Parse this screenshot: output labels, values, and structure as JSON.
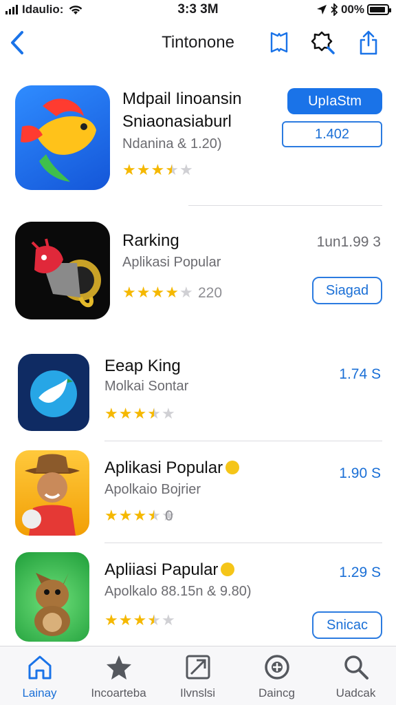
{
  "status_bar": {
    "carrier": "Idaulio:",
    "time": "3:3 3M",
    "battery": "00%",
    "battery_level": 0.9
  },
  "nav": {
    "title": "Tintonone",
    "icons": [
      "chevron-left-icon",
      "bookmark-icon",
      "search-badge-icon",
      "share-icon"
    ]
  },
  "apps": [
    {
      "name_line1": "Mdpail Iinoansin",
      "name_line2": "Sniaonasiaburl",
      "subtitle": "Ndanina & 1.20)",
      "rating": 3.5,
      "primary_button": "UpIaStm",
      "price_button": "1.402"
    },
    {
      "name": "Rarking",
      "subtitle": "Aplikasi Popular",
      "rating": 4,
      "rating_count": "220",
      "price": "1un1.99 3",
      "button": "Siagad"
    },
    {
      "name": "Eeap King",
      "subtitle": "Molkai Sontar",
      "rating": 3.5,
      "price": "1.74 S"
    },
    {
      "name": "Aplikasi Popular",
      "subtitle": "Apolkaio Bojrier",
      "rating": 3.5,
      "rating_count": "0",
      "price": "1.90 S"
    },
    {
      "name": "Apliiasi Papular",
      "subtitle": "Apolkalo 88.15n & 9.80)",
      "rating": 3.5,
      "price": "1.29 S",
      "button": "Snicac"
    }
  ],
  "tabs": [
    {
      "label": "Lainay",
      "icon": "home-icon",
      "active": true
    },
    {
      "label": "Incoarteba",
      "icon": "star-icon",
      "active": false
    },
    {
      "label": "Ilvnslsi",
      "icon": "apps-icon",
      "active": false
    },
    {
      "label": "Daincg",
      "icon": "games-icon",
      "active": false
    },
    {
      "label": "Uadcak",
      "icon": "search-icon",
      "active": false
    }
  ],
  "colors": {
    "accent": "#1a73e8",
    "star": "#f5b800",
    "star_empty": "#d0d0d4"
  }
}
